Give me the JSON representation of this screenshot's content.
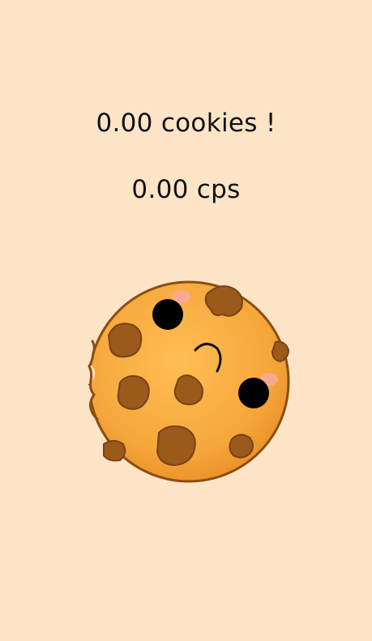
{
  "game": {
    "cookie_count_text": "0.00 cookies !",
    "cps_text": "0.00 cps"
  },
  "colors": {
    "background": "#fee4c7",
    "cookie_base": "#f6a73b",
    "cookie_outline": "#8a4e10",
    "chip": "#9a5a1c",
    "eye": "#000000",
    "blush": "#f7a9a0"
  },
  "cookie": {
    "icon": "cookie-face-icon"
  }
}
